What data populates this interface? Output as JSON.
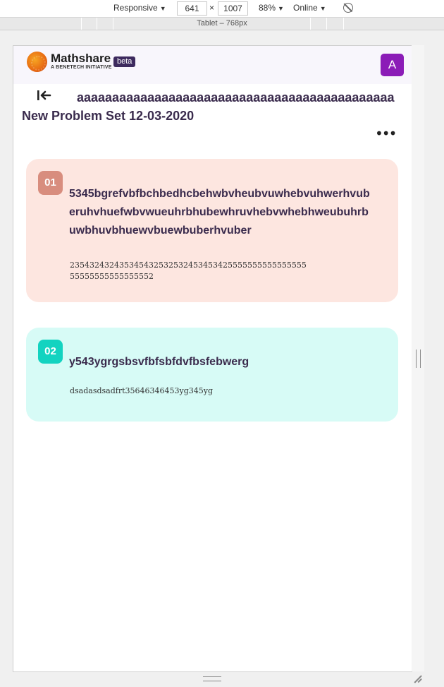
{
  "devtools": {
    "device": "Responsive",
    "width": "641",
    "times": "×",
    "height": "1007",
    "zoom": "88%",
    "network": "Online",
    "media_query": "Tablet – 768px"
  },
  "header": {
    "brand": "Mathshare",
    "brand_sub": "A BENETECH INITIATIVE",
    "badge": "beta",
    "avatar_initial": "A",
    "avatar_color": "#8b1cb7"
  },
  "problem_set": {
    "title": "aaaaaaaaaaaaaaaaaaaaaaaaaaaaaaaaaaaaaaaaaaaaaNew Problem Set 12-03-2020",
    "more_label": "•••"
  },
  "problems": [
    {
      "number": "01",
      "title": "5345bgrefvbfbchbedhcbehwbvheubvuwhebvuhwerhvuberuhvhuefwbvwueuhrbhubewhruvhebvwhebhweubuhrbuwbhuvbhuewvbuewbuberhvuber",
      "body": "23543243243534543253253245345342555555555555555555555555555555552",
      "color": "#fde6e0"
    },
    {
      "number": "02",
      "title": "y543ygrgsbsvfbfsbfdvfbsfebwerg",
      "body": "dsadasdsadfrt35646346453yg345yg",
      "color": "#d7fbf6"
    }
  ]
}
